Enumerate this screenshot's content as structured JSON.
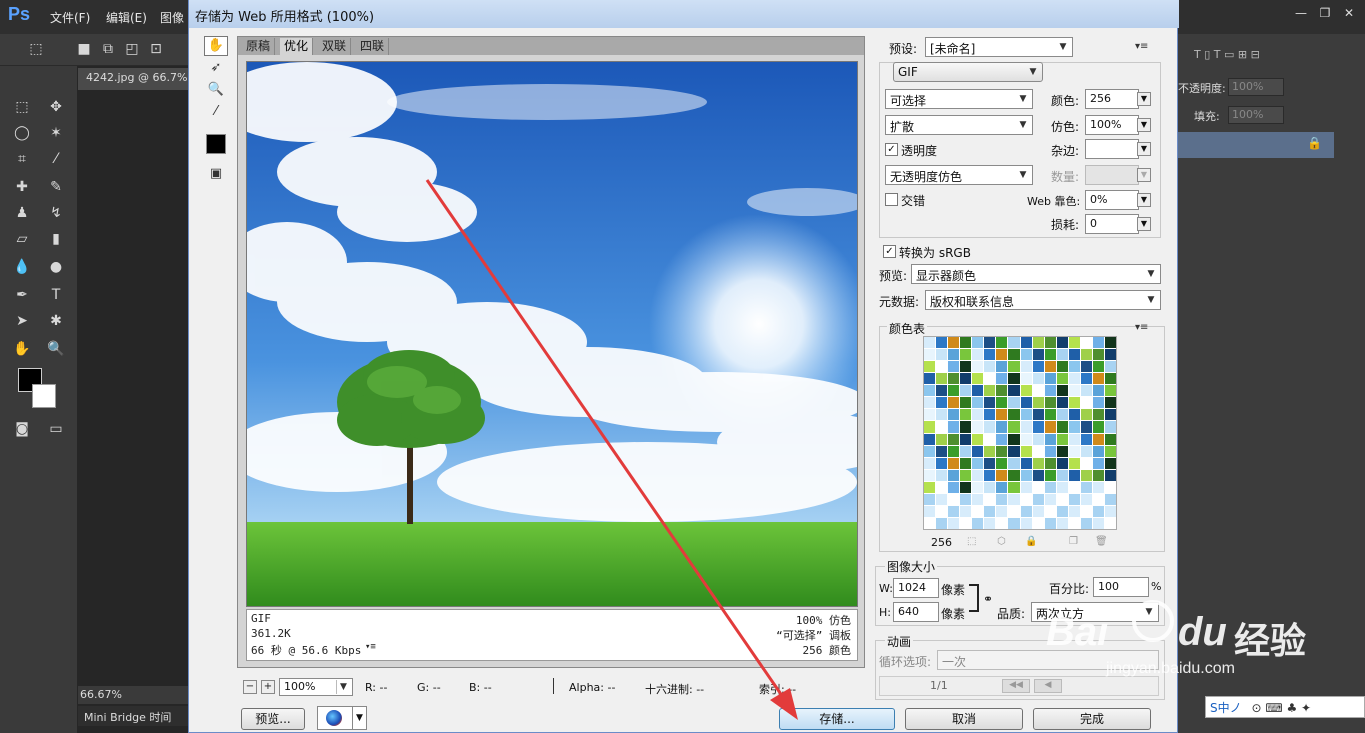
{
  "ps": {
    "logo": "Ps",
    "menus": [
      "文件(F)",
      "编辑(E)",
      "图像"
    ],
    "doc_tab": "4242.jpg @ 66.7%",
    "zoom_status": "66.67%",
    "bottom_tabs": "Mini Bridge  时间",
    "right_panel": {
      "opacity_label": "不透明度:",
      "opacity_value": "100%",
      "fill_label": "填充:",
      "fill_value": "100%"
    }
  },
  "dialog": {
    "title": "存储为 Web 所用格式 (100%)",
    "tabs": [
      "原稿",
      "优化",
      "双联",
      "四联"
    ],
    "selected_tab": "优化",
    "info_left": [
      "GIF",
      "361.2K",
      "66 秒 @ 56.6 Kbps"
    ],
    "info_right": [
      "100% 仿色",
      "“可选择” 调板",
      "256 颜色"
    ],
    "zoom": {
      "value": "100%",
      "minus": "−",
      "plus": "+"
    },
    "readouts": {
      "r": "R: --",
      "g": "G: --",
      "b": "B: --",
      "alpha": "Alpha: --",
      "hex": "十六进制: --",
      "index": "索引: --"
    },
    "buttons": {
      "preview": "预览...",
      "save": "存储...",
      "cancel": "取消",
      "done": "完成"
    },
    "settings": {
      "preset_label": "预设:",
      "preset_value": "[未命名]",
      "format": "GIF",
      "reduction": "可选择",
      "colors_label": "颜色:",
      "colors_value": "256",
      "dither_algo": "扩散",
      "dither_label": "仿色:",
      "dither_value": "100%",
      "transparency_label": "透明度",
      "transparency_checked": true,
      "matte_label": "杂边:",
      "matte_value": "",
      "trans_dither": "无透明度仿色",
      "amount_label": "数量:",
      "amount_value": "",
      "interlaced_label": "交错",
      "interlaced_checked": false,
      "web_snap_label": "Web 靠色:",
      "web_snap_value": "0%",
      "lossy_label": "损耗:",
      "lossy_value": "0",
      "srgb_label": "转换为 sRGB",
      "srgb_checked": true,
      "preview_label": "预览:",
      "preview_value": "显示器颜色",
      "metadata_label": "元数据:",
      "metadata_value": "版权和联系信息"
    },
    "color_table": {
      "title": "颜色表",
      "count": "256"
    },
    "image_size": {
      "title": "图像大小",
      "w_label": "W:",
      "w_value": "1024",
      "h_label": "H:",
      "h_value": "640",
      "unit": "像素",
      "percent_label": "百分比:",
      "percent_value": "100",
      "percent_unit": "%",
      "quality_label": "品质:",
      "quality_value": "两次立方"
    },
    "animation": {
      "title": "动画",
      "loop_label": "循环选项:",
      "loop_value": "一次",
      "frame": "1/1"
    }
  },
  "watermark": {
    "brand": "Bai",
    "brand2": "du",
    "cn": "经验",
    "url": "jingyan.baidu.com"
  },
  "ime": {
    "text": "S中ノ"
  },
  "colors": {
    "accent_arrow": "#e23b3b",
    "ps_bg": "#535353",
    "dialog_bg": "#f0f0f0"
  }
}
